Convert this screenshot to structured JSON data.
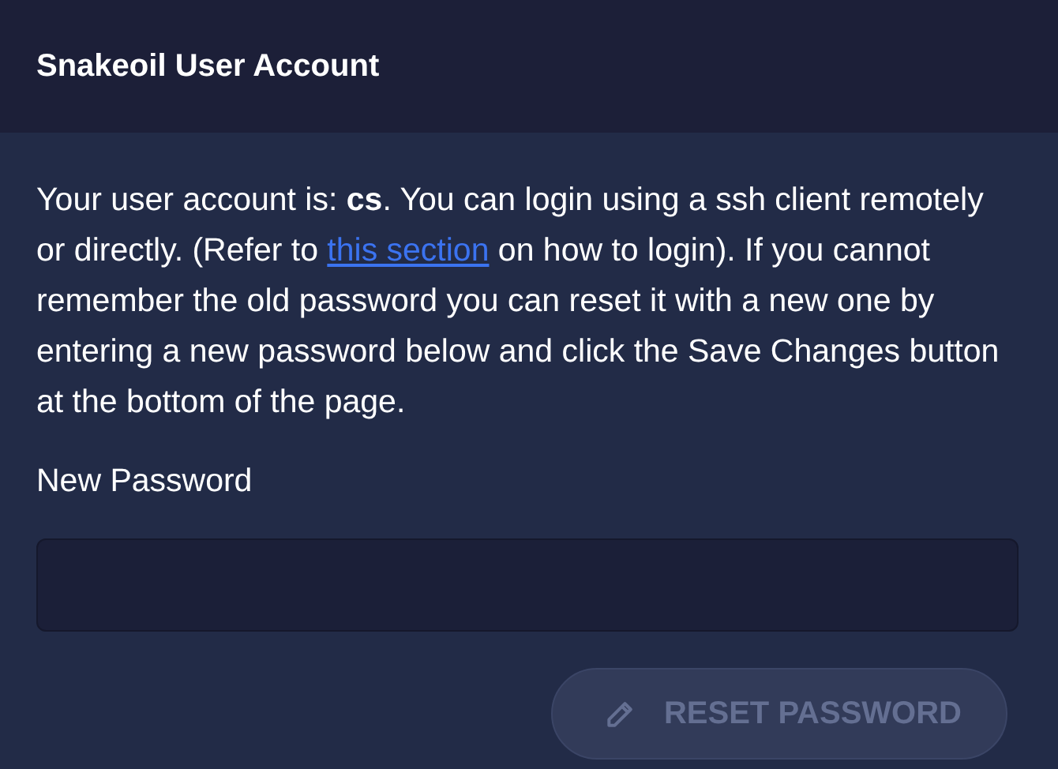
{
  "header": {
    "title": "Snakeoil User Account"
  },
  "description": {
    "before": "Your user account is: **cs**. You can login using a ssh client remotely or directly. (Refer to ",
    "link": "this section",
    "after": " on how to login). If you cannot remember the old password you can reset it with a new one by entering a new password below and click the Save Changes button at the bottom of the page."
  },
  "password_field": {
    "label": "New Password"
  },
  "reset_button": {
    "label": "RESET PASSWORD",
    "disabled": true
  }
}
